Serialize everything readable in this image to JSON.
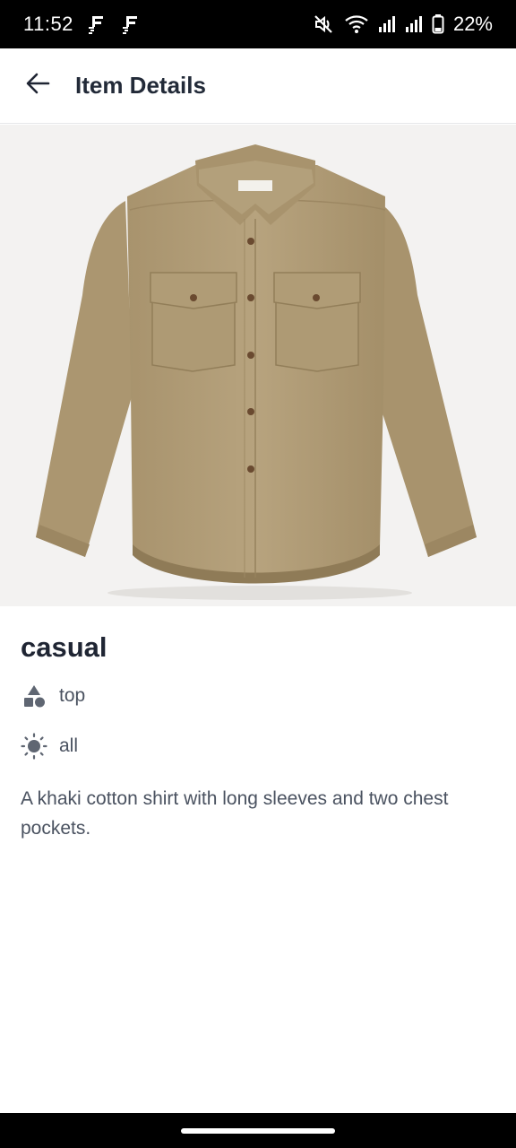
{
  "status_bar": {
    "time": "11:52",
    "battery": "22%",
    "icons": [
      "notification-f-icon",
      "notification-f-icon",
      "mute-icon",
      "wifi-icon",
      "signal-icon",
      "signal-icon",
      "battery-icon"
    ]
  },
  "app_bar": {
    "back_icon": "arrow-back-icon",
    "title": "Item Details"
  },
  "item": {
    "image_description_icon": "khaki-shirt-photo",
    "name": "casual",
    "category": "top",
    "category_icon": "shapes-icon",
    "season": "all",
    "season_icon": "sun-icon",
    "description": "A khaki cotton shirt with long sleeves and two chest pockets."
  },
  "colors": {
    "text_primary": "#1f2533",
    "text_secondary": "#4a5260",
    "icon_gray": "#5f6672",
    "shirt_khaki": "#b4a07c"
  }
}
